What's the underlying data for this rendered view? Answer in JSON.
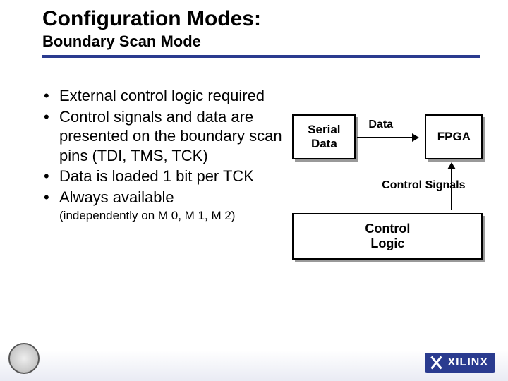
{
  "title": "Configuration Modes:",
  "subtitle": "Boundary Scan Mode",
  "bullets": [
    "External control logic required",
    "Control signals and data are presented on the boundary scan pins (TDI, TMS, TCK)",
    "Data is loaded 1 bit per TCK",
    "Always available"
  ],
  "note": "(independently on M 0, M 1, M 2)",
  "diagram": {
    "serial": "Serial\nData",
    "fpga": "FPGA",
    "control_logic": "Control\nLogic",
    "data_label": "Data",
    "ctrl_label": "Control Signals"
  },
  "brand": "XILINX"
}
